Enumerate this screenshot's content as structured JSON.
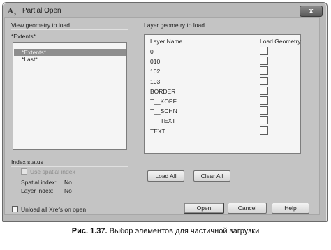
{
  "window": {
    "app_icon_text": "A",
    "app_icon_sub": "?",
    "title": "Partial Open",
    "close_glyph": "x"
  },
  "view_group": {
    "label": "View geometry to load",
    "current": "*Extents*",
    "items": [
      {
        "label": "*Extents*",
        "selected": true
      },
      {
        "label": "*Last*",
        "selected": false
      }
    ]
  },
  "layer_group": {
    "label": "Layer geometry to load",
    "columns": {
      "name": "Layer Name",
      "load": "Load Geometry"
    },
    "rows": [
      {
        "name": "0",
        "checked": false
      },
      {
        "name": "010",
        "checked": false
      },
      {
        "name": "102",
        "checked": false
      },
      {
        "name": "103",
        "checked": false
      },
      {
        "name": "BORDER",
        "checked": false
      },
      {
        "name": "T__KOPF",
        "checked": false
      },
      {
        "name": "T__SCHN",
        "checked": false
      },
      {
        "name": "T__TEXT",
        "checked": false
      },
      {
        "name": "TEXT",
        "checked": false
      }
    ]
  },
  "index_status": {
    "label": "Index status",
    "use_spatial_index": "Use spatial index",
    "spatial_label": "Spatial index:",
    "spatial_value": "No",
    "layer_label": "Layer index:",
    "layer_value": "No"
  },
  "buttons": {
    "load_all": "Load All",
    "clear_all": "Clear All",
    "open": "Open",
    "cancel": "Cancel",
    "help": "Help"
  },
  "unload_xrefs": "Unload all Xrefs on open",
  "caption": {
    "bold": "Рис. 1.37.",
    "text": " Выбор элементов для частичной загрузки"
  },
  "colors": {
    "dialog_bg": "#c4c4c4",
    "list_bg": "#f5f5f5",
    "selection": "#8e8e8e"
  }
}
